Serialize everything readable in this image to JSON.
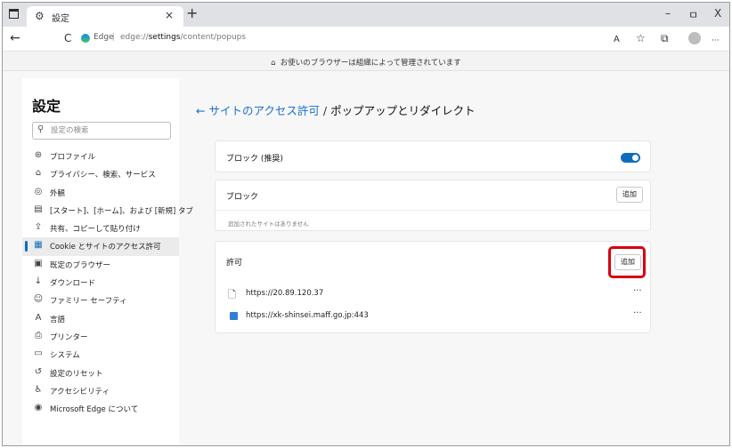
{
  "window": {
    "tab_title": "設定",
    "tab_close": "×",
    "new_tab": "+",
    "minimize": "–",
    "restore": "ㅁ",
    "close": "X"
  },
  "toolbar": {
    "back": "←",
    "refresh": "C",
    "address_browser": "Edge",
    "address_separator": "|",
    "address_prefix": "edge://",
    "address_bold": "settings",
    "address_suffix": "/content/popups",
    "read_aloud": "A",
    "favorites": "☆",
    "collections": "⧉",
    "more": "···"
  },
  "managed_banner": {
    "icon": "⌂",
    "text": "お使いのブラウザーは組織によって管理されています"
  },
  "sidebar": {
    "title": "設定",
    "search_placeholder": "設定の検索",
    "search_icon": "⚲",
    "items": [
      {
        "icon": "⊛",
        "label": "プロファイル"
      },
      {
        "icon": "⌂",
        "label": "プライバシー、検索、サービス"
      },
      {
        "icon": "◎",
        "label": "外観"
      },
      {
        "icon": "▤",
        "label": "[スタート]、[ホーム]、および [新規] タブ"
      },
      {
        "icon": "⇪",
        "label": "共有、コピーして貼り付け"
      },
      {
        "icon": "▦",
        "label": "Cookie とサイトのアクセス許可"
      },
      {
        "icon": "▣",
        "label": "既定のブラウザー"
      },
      {
        "icon": "↓",
        "label": "ダウンロード"
      },
      {
        "icon": "☺",
        "label": "ファミリー セーフティ"
      },
      {
        "icon": "A",
        "label": "言語"
      },
      {
        "icon": "⎙",
        "label": "プリンター"
      },
      {
        "icon": "▭",
        "label": "システム"
      },
      {
        "icon": "↺",
        "label": "設定のリセット"
      },
      {
        "icon": "♿",
        "label": "アクセシビリティ"
      },
      {
        "icon": "◉",
        "label": "Microsoft Edge について"
      }
    ]
  },
  "main": {
    "breadcrumb_back": "←",
    "breadcrumb_parent": "サイトのアクセス許可",
    "breadcrumb_separator": "/",
    "breadcrumb_current": "ポップアップとリダイレクト",
    "block_recommended_label": "ブロック (推奨)",
    "block_label": "ブロック",
    "block_add_button": "追加",
    "block_empty_message": "追加されたサイトはありません",
    "allow_label": "許可",
    "allow_add_button": "追加",
    "allowed_sites": [
      {
        "icon": "🗋",
        "url": "https://20.89.120.37",
        "more": "···"
      },
      {
        "icon": "",
        "url": "https://xk-shinsei.maff.go.jp:443",
        "more": "···"
      }
    ]
  },
  "colors": {
    "accent": "#0f6cbd",
    "highlight": "#d7000f"
  }
}
